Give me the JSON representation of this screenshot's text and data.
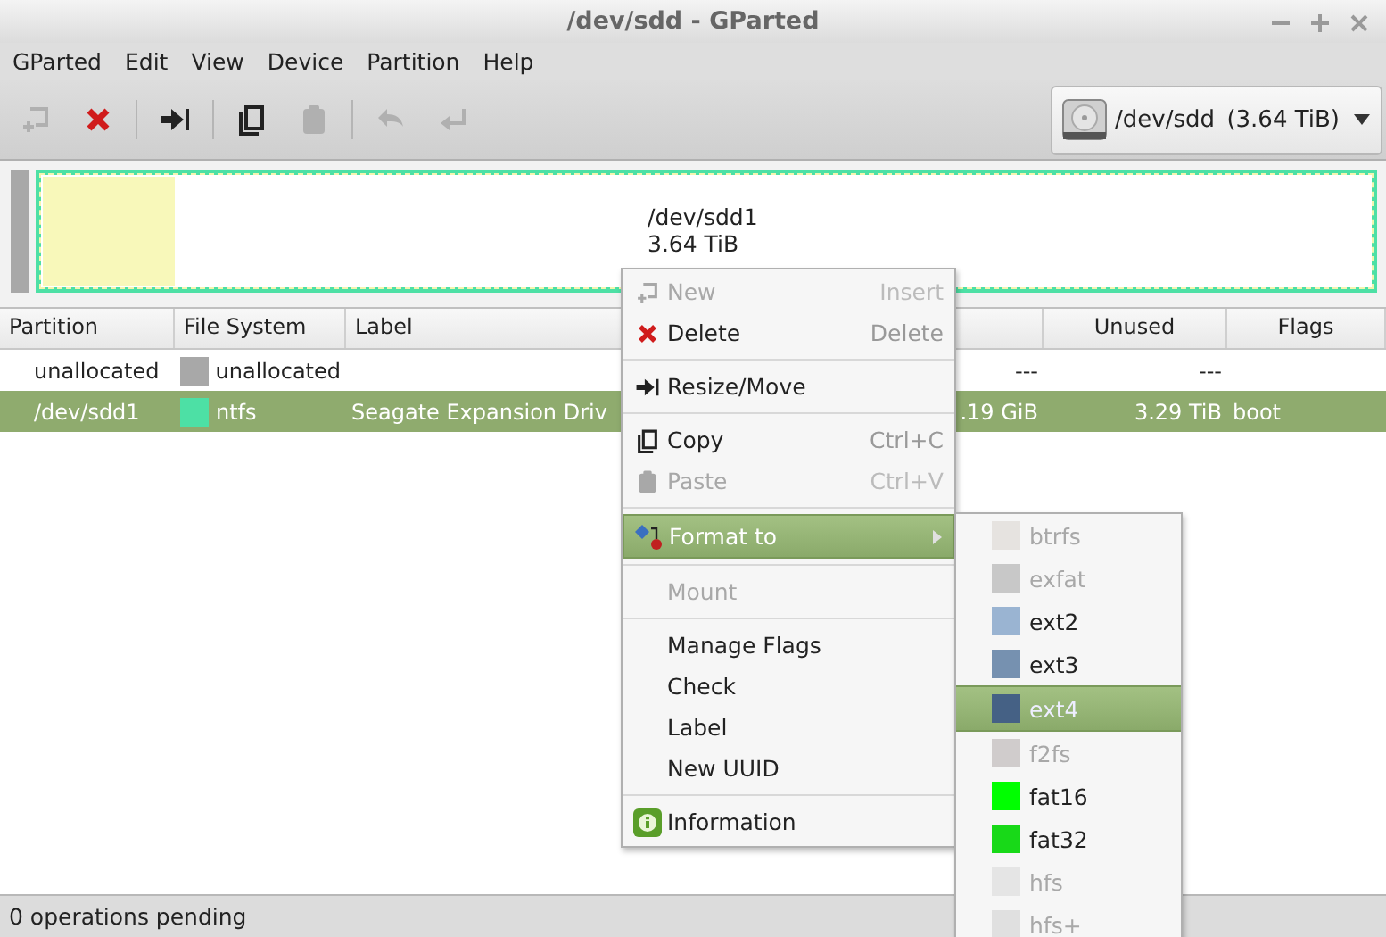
{
  "window": {
    "title": "/dev/sdd - GParted"
  },
  "menubar": [
    "GParted",
    "Edit",
    "View",
    "Device",
    "Partition",
    "Help"
  ],
  "toolbar": [
    {
      "kind": "new",
      "disabled": true
    },
    {
      "kind": "delete",
      "disabled": false
    },
    {
      "kind": "separator"
    },
    {
      "kind": "resize",
      "disabled": false
    },
    {
      "kind": "separator"
    },
    {
      "kind": "copy",
      "disabled": false
    },
    {
      "kind": "paste",
      "disabled": true
    },
    {
      "kind": "separator"
    },
    {
      "kind": "undo",
      "disabled": true
    },
    {
      "kind": "apply",
      "disabled": true
    }
  ],
  "device_selector": {
    "device": "/dev/sdd",
    "size": "(3.64 TiB)"
  },
  "disk_map": {
    "partition": "/dev/sdd1",
    "size": "3.64 TiB",
    "level": 0.1,
    "selected": true
  },
  "table": {
    "columns": [
      "Partition",
      "File System",
      "Label",
      "Unused",
      "Flags"
    ],
    "rows": [
      {
        "partition": "unallocated",
        "color": "#a8a8a8",
        "file_system": "unallocated",
        "used": "---",
        "unused": "---",
        "selected": false
      },
      {
        "partition": "/dev/sdd1",
        "color": "#4de0a5",
        "file_system": "ntfs",
        "label": "Seagate Expansion Driv",
        "used": ".19 GiB",
        "unused": "3.29 TiB",
        "flags": "boot",
        "selected": true
      }
    ]
  },
  "context_menu": [
    {
      "kind": "item",
      "label": "New",
      "shortcut": "Insert",
      "disabled": true,
      "selected": false
    },
    {
      "kind": "item",
      "label": "Delete",
      "shortcut": "Delete",
      "disabled": false,
      "selected": false
    },
    {
      "kind": "separator"
    },
    {
      "kind": "item",
      "label": "Resize/Move",
      "disabled": false,
      "selected": false
    },
    {
      "kind": "separator"
    },
    {
      "kind": "item",
      "label": "Copy",
      "shortcut": "Ctrl+C",
      "disabled": false,
      "selected": false
    },
    {
      "kind": "item",
      "label": "Paste",
      "shortcut": "Ctrl+V",
      "disabled": true,
      "selected": false
    },
    {
      "kind": "separator"
    },
    {
      "kind": "submenu",
      "label": "Format to",
      "disabled": false,
      "selected": true
    },
    {
      "kind": "separator"
    },
    {
      "kind": "item",
      "label": "Mount",
      "disabled": true,
      "selected": false
    },
    {
      "kind": "separator"
    },
    {
      "kind": "item",
      "label": "Manage Flags",
      "disabled": false,
      "selected": false
    },
    {
      "kind": "item",
      "label": "Check",
      "disabled": false,
      "selected": false
    },
    {
      "kind": "item",
      "label": "Label",
      "disabled": false,
      "selected": false
    },
    {
      "kind": "item",
      "label": "New UUID",
      "disabled": false,
      "selected": false
    },
    {
      "kind": "separator"
    },
    {
      "kind": "item",
      "label": "Information",
      "disabled": false,
      "selected": false
    }
  ],
  "format_submenu": [
    {
      "label": "btrfs",
      "color": "#e6e3e0",
      "disabled": true,
      "selected": false
    },
    {
      "label": "exfat",
      "color": "#c8c8c8",
      "disabled": true,
      "selected": false
    },
    {
      "label": "ext2",
      "color": "#9ab4d2",
      "disabled": false,
      "selected": false
    },
    {
      "label": "ext3",
      "color": "#7691b0",
      "disabled": false,
      "selected": false
    },
    {
      "label": "ext4",
      "color": "#456185",
      "disabled": false,
      "selected": true
    },
    {
      "label": "f2fs",
      "color": "#d0cccc",
      "disabled": true,
      "selected": false
    },
    {
      "label": "fat16",
      "color": "#00ff00",
      "disabled": false,
      "selected": false
    },
    {
      "label": "fat32",
      "color": "#18d918",
      "disabled": false,
      "selected": false
    },
    {
      "label": "hfs",
      "color": "#e5e5e5",
      "disabled": true,
      "selected": false
    },
    {
      "label": "hfs+",
      "color": "#e0e0e0",
      "disabled": true,
      "selected": false
    }
  ],
  "status_bar": "0 operations pending"
}
